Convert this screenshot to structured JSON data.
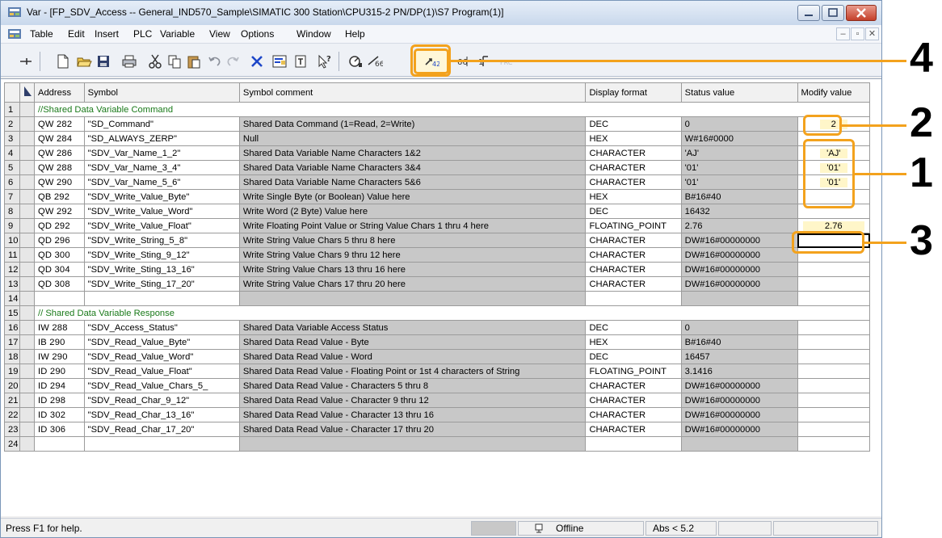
{
  "window": {
    "title": "Var - [FP_SDV_Access -- General_IND570_Sample\\SIMATIC 300 Station\\CPU315-2 PN/DP(1)\\S7 Program(1)]"
  },
  "menu": [
    "Table",
    "Edit",
    "Insert",
    "PLC",
    "Variable",
    "View",
    "Options",
    "Window",
    "Help"
  ],
  "table": {
    "headers": [
      "Address",
      "Symbol",
      "Symbol comment",
      "Display format",
      "Status value",
      "Modify value"
    ],
    "rows": [
      {
        "n": "1",
        "comment": "//Shared Data Variable Command"
      },
      {
        "n": "2",
        "addr": "QW  282",
        "sym": "\"SD_Command\"",
        "cmt": "Shared Data Command (1=Read, 2=Write)",
        "fmt": "DEC",
        "status": "0",
        "mod": "2"
      },
      {
        "n": "3",
        "addr": "QW  284",
        "sym": "\"SD_ALWAYS_ZERP\"",
        "cmt": "Null",
        "fmt": "HEX",
        "status": "W#16#0000",
        "mod": ""
      },
      {
        "n": "4",
        "addr": "QW  286",
        "sym": "\"SDV_Var_Name_1_2\"",
        "cmt": "Shared Data Variable Name Characters 1&2",
        "fmt": "CHARACTER",
        "status": "'AJ'",
        "mod": "'AJ'"
      },
      {
        "n": "5",
        "addr": "QW  288",
        "sym": "\"SDV_Var_Name_3_4\"",
        "cmt": "Shared Data Variable Name Characters 3&4",
        "fmt": "CHARACTER",
        "status": "'01'",
        "mod": "'01'"
      },
      {
        "n": "6",
        "addr": "QW  290",
        "sym": "\"SDV_Var_Name_5_6\"",
        "cmt": "Shared Data Variable Name Characters 5&6",
        "fmt": "CHARACTER",
        "status": "'01'",
        "mod": "'01'"
      },
      {
        "n": "7",
        "addr": "QB  292",
        "sym": "\"SDV_Write_Value_Byte\"",
        "cmt": "Write Single Byte (or Boolean) Value here",
        "fmt": "HEX",
        "status": "B#16#40",
        "mod": ""
      },
      {
        "n": "8",
        "addr": "QW  292",
        "sym": "\"SDV_Write_Value_Word\"",
        "cmt": "Write Word (2 Byte) Value here",
        "fmt": "DEC",
        "status": "16432",
        "mod": ""
      },
      {
        "n": "9",
        "addr": "QD  292",
        "sym": "\"SDV_Write_Value_Float\"",
        "cmt": "Write Floating Point Value or String Value Chars 1 thru 4 here",
        "fmt": "FLOATING_POINT",
        "status": "2.76",
        "mod": "2.76"
      },
      {
        "n": "10",
        "addr": "QD  296",
        "sym": "\"SDV_Write_String_5_8\"",
        "cmt": "Write String Value Chars 5 thru 8 here",
        "fmt": "CHARACTER",
        "status": "DW#16#00000000",
        "mod": ""
      },
      {
        "n": "11",
        "addr": "QD  300",
        "sym": "\"SDV_Write_Sting_9_12\"",
        "cmt": "Write String Value Chars 9 thru 12 here",
        "fmt": "CHARACTER",
        "status": "DW#16#00000000",
        "mod": ""
      },
      {
        "n": "12",
        "addr": "QD  304",
        "sym": "\"SDV_Write_Sting_13_16\"",
        "cmt": "Write String Value Chars 13 thru 16 here",
        "fmt": "CHARACTER",
        "status": "DW#16#00000000",
        "mod": ""
      },
      {
        "n": "13",
        "addr": "QD  308",
        "sym": "\"SDV_Write_Sting_17_20\"",
        "cmt": "Write String Value Chars 17 thru 20 here",
        "fmt": "CHARACTER",
        "status": "DW#16#00000000",
        "mod": ""
      },
      {
        "n": "14",
        "blank": true
      },
      {
        "n": "15",
        "comment": "// Shared Data Variable Response"
      },
      {
        "n": "16",
        "addr": "IW  288",
        "sym": "\"SDV_Access_Status\"",
        "cmt": "Shared Data Variable Access Status",
        "fmt": "DEC",
        "status": "0",
        "mod": ""
      },
      {
        "n": "17",
        "addr": "IB  290",
        "sym": "\"SDV_Read_Value_Byte\"",
        "cmt": "Shared Data Read Value - Byte",
        "fmt": "HEX",
        "status": "B#16#40",
        "mod": ""
      },
      {
        "n": "18",
        "addr": "IW  290",
        "sym": "\"SDV_Read_Value_Word\"",
        "cmt": "Shared Data Read Value - Word",
        "fmt": "DEC",
        "status": "16457",
        "mod": ""
      },
      {
        "n": "19",
        "addr": "ID  290",
        "sym": "\"SDV_Read_Value_Float\"",
        "cmt": "Shared Data Read Value - Floating Point or 1st 4 characters of String",
        "fmt": "FLOATING_POINT",
        "status": "3.1416",
        "mod": ""
      },
      {
        "n": "20",
        "addr": "ID  294",
        "sym": "\"SDV_Read_Value_Chars_5_",
        "cmt": "Shared Data Read Value - Characters 5 thru 8",
        "fmt": "CHARACTER",
        "status": "DW#16#00000000",
        "mod": ""
      },
      {
        "n": "21",
        "addr": "ID  298",
        "sym": "\"SDV_Read_Char_9_12\"",
        "cmt": "Shared Data Read Value - Character 9 thru 12",
        "fmt": "CHARACTER",
        "status": "DW#16#00000000",
        "mod": ""
      },
      {
        "n": "22",
        "addr": "ID  302",
        "sym": "\"SDV_Read_Char_13_16\"",
        "cmt": "Shared Data Read Value - Character 13 thru 16",
        "fmt": "CHARACTER",
        "status": "DW#16#00000000",
        "mod": ""
      },
      {
        "n": "23",
        "addr": "ID  306",
        "sym": "\"SDV_Read_Char_17_20\"",
        "cmt": "Shared Data Read Value - Character 17 thru 20",
        "fmt": "CHARACTER",
        "status": "DW#16#00000000",
        "mod": ""
      },
      {
        "n": "24",
        "blank": true
      }
    ]
  },
  "statusbar": {
    "help": "Press F1 for help.",
    "mode": "Offline",
    "abs": "Abs < 5.2"
  },
  "callouts": {
    "one": "1",
    "two": "2",
    "three": "3",
    "four": "4"
  },
  "colors": {
    "callout": "#f3a21d",
    "status_col_bg": "#c8c8c8",
    "comment_green": "#1a7a1a"
  },
  "icons": [
    "app-icon",
    "pin-icon",
    "new-icon",
    "open-icon",
    "save-icon",
    "print-icon",
    "cut-icon",
    "copy-icon",
    "paste-icon",
    "undo-icon",
    "redo-icon",
    "delete-icon",
    "monitor-var-icon",
    "force-icon",
    "help-pointer-icon",
    "monitor-icon",
    "modify-icon",
    "modify-now-icon",
    "trigger-icon",
    "enable-peripheral-icon",
    "force-values-icon"
  ]
}
